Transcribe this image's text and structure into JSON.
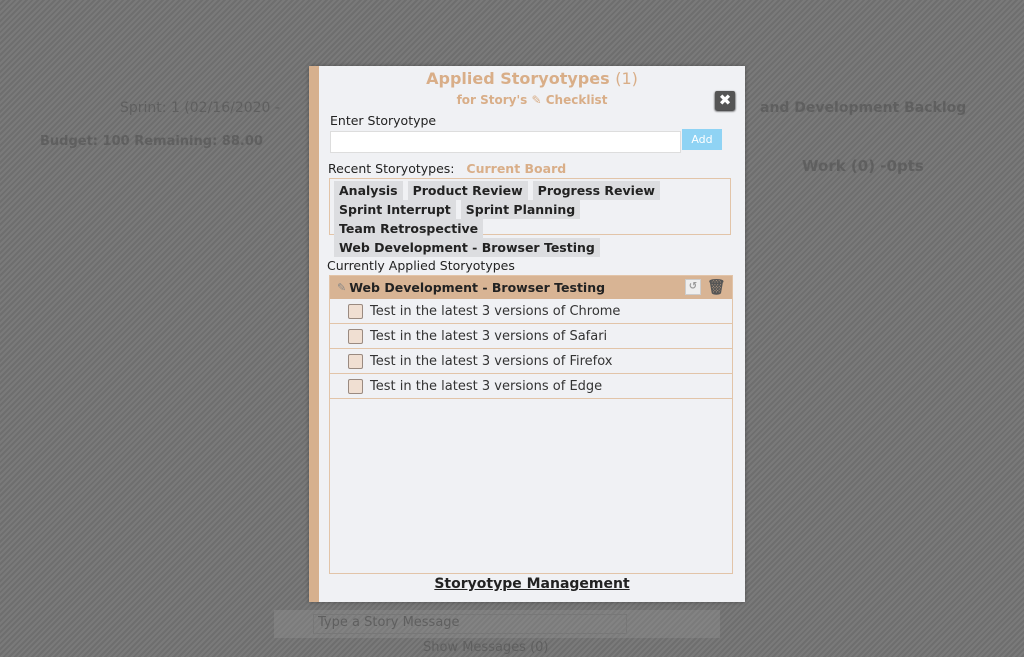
{
  "background": {
    "sprint": "Sprint: 1 (02/16/2020 -",
    "budget": "Budget: 100   Remaining: 88.00",
    "backlog": "and Development Backlog",
    "work": "Work (0) -0pts",
    "message_placeholder": "Type a Story Message",
    "show_messages": "Show Messages (0)"
  },
  "modal": {
    "title": "Applied Storyotypes",
    "title_count": "(1)",
    "subtitle_prefix": "for Story's",
    "subtitle_suffix": "Checklist",
    "close_label": "✖",
    "enter_label": "Enter Storyotype",
    "input_value": "",
    "add_label": "Add",
    "recent_label": "Recent Storyotypes:",
    "recent_scope": "Current Board",
    "recent_tags": [
      "Analysis",
      "Product Review",
      "Progress Review",
      "Sprint Interrupt",
      "Sprint Planning",
      "Team Retrospective",
      "Web Development - Browser Testing"
    ],
    "applied_label": "Currently Applied Storyotypes",
    "applied": {
      "name": "Web Development - Browser Testing",
      "items": [
        "Test in the latest 3 versions of Chrome",
        "Test in the latest 3 versions of Safari",
        "Test in the latest 3 versions of Firefox",
        "Test in the latest 3 versions of Edge"
      ]
    },
    "management_link": "Storyotype Management"
  },
  "colors": {
    "accent": "#d6b08e",
    "add_button": "#8fd3f4",
    "header_row": "#d8b494"
  }
}
